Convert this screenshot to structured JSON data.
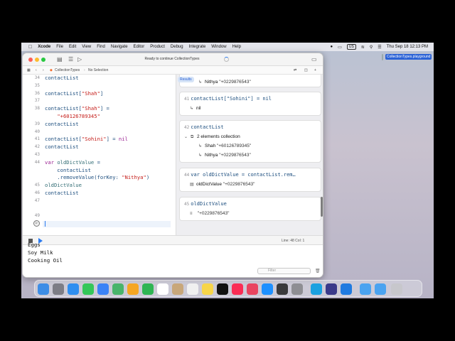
{
  "menubar": {
    "app": "Xcode",
    "items": [
      "File",
      "Edit",
      "View",
      "Find",
      "Navigate",
      "Editor",
      "Product",
      "Debug",
      "Integrate",
      "Window",
      "Help"
    ],
    "input_source": "US",
    "clock": "Thu Sep 18  12:13 PM"
  },
  "desktop_file": {
    "name": "CollectionTypes.playground"
  },
  "window": {
    "status": "Ready to continue CollectionTypes",
    "jumpbar": {
      "file": "CollectionTypes",
      "selection": "No Selection"
    }
  },
  "editor": {
    "lines": [
      {
        "n": "34",
        "code": "contactList"
      },
      {
        "n": "35",
        "code": ""
      },
      {
        "n": "36",
        "code": "contactList[\"Shah\"]"
      },
      {
        "n": "37",
        "code": ""
      },
      {
        "n": "38",
        "code": "contactList[\"Shah\"] ="
      },
      {
        "n": "",
        "code": "    \"+60126789345\""
      },
      {
        "n": "39",
        "code": "contactList"
      },
      {
        "n": "40",
        "code": ""
      },
      {
        "n": "41",
        "code": "contactList[\"Sohini\"] = nil"
      },
      {
        "n": "42",
        "code": "contactList"
      },
      {
        "n": "43",
        "code": ""
      },
      {
        "n": "44",
        "code": "var oldDictValue ="
      },
      {
        "n": "",
        "code": "    contactList"
      },
      {
        "n": "",
        "code": "    .removeValue(forKey: \"Nithya\")"
      },
      {
        "n": "45",
        "code": "oldDictValue"
      },
      {
        "n": "46",
        "code": "contactList"
      },
      {
        "n": "47",
        "code": ""
      },
      {
        "n": "",
        "code": ""
      },
      {
        "n": "49",
        "code": ""
      }
    ]
  },
  "results": {
    "badge": "Results",
    "card1": {
      "key": "Nithya",
      "value": "\"+0229876543\""
    },
    "card2": {
      "line": "41",
      "code": "contactList[\"Sohini\"] = nil",
      "result": "nil"
    },
    "card3": {
      "line": "42",
      "code": "contactList",
      "summary": "2 elements collection",
      "entries": [
        {
          "key": "Shah",
          "value": "\"+60126789345\""
        },
        {
          "key": "Nithya",
          "value": "\"+0229876543\""
        }
      ]
    },
    "card4": {
      "line": "44",
      "code": "var oldDictValue = contactList.rem…",
      "name": "oldDictValue",
      "value": "\"+0229876543\""
    },
    "card5": {
      "line": "45",
      "code": "oldDictValue",
      "value": "\"+0229876543\""
    }
  },
  "debugbar": {
    "lineinfo": "Line: 48  Col: 1"
  },
  "console": {
    "lines": [
      "Eggs",
      "Soy Milk",
      "Cooking Oil"
    ],
    "filter_placeholder": "Filter"
  }
}
